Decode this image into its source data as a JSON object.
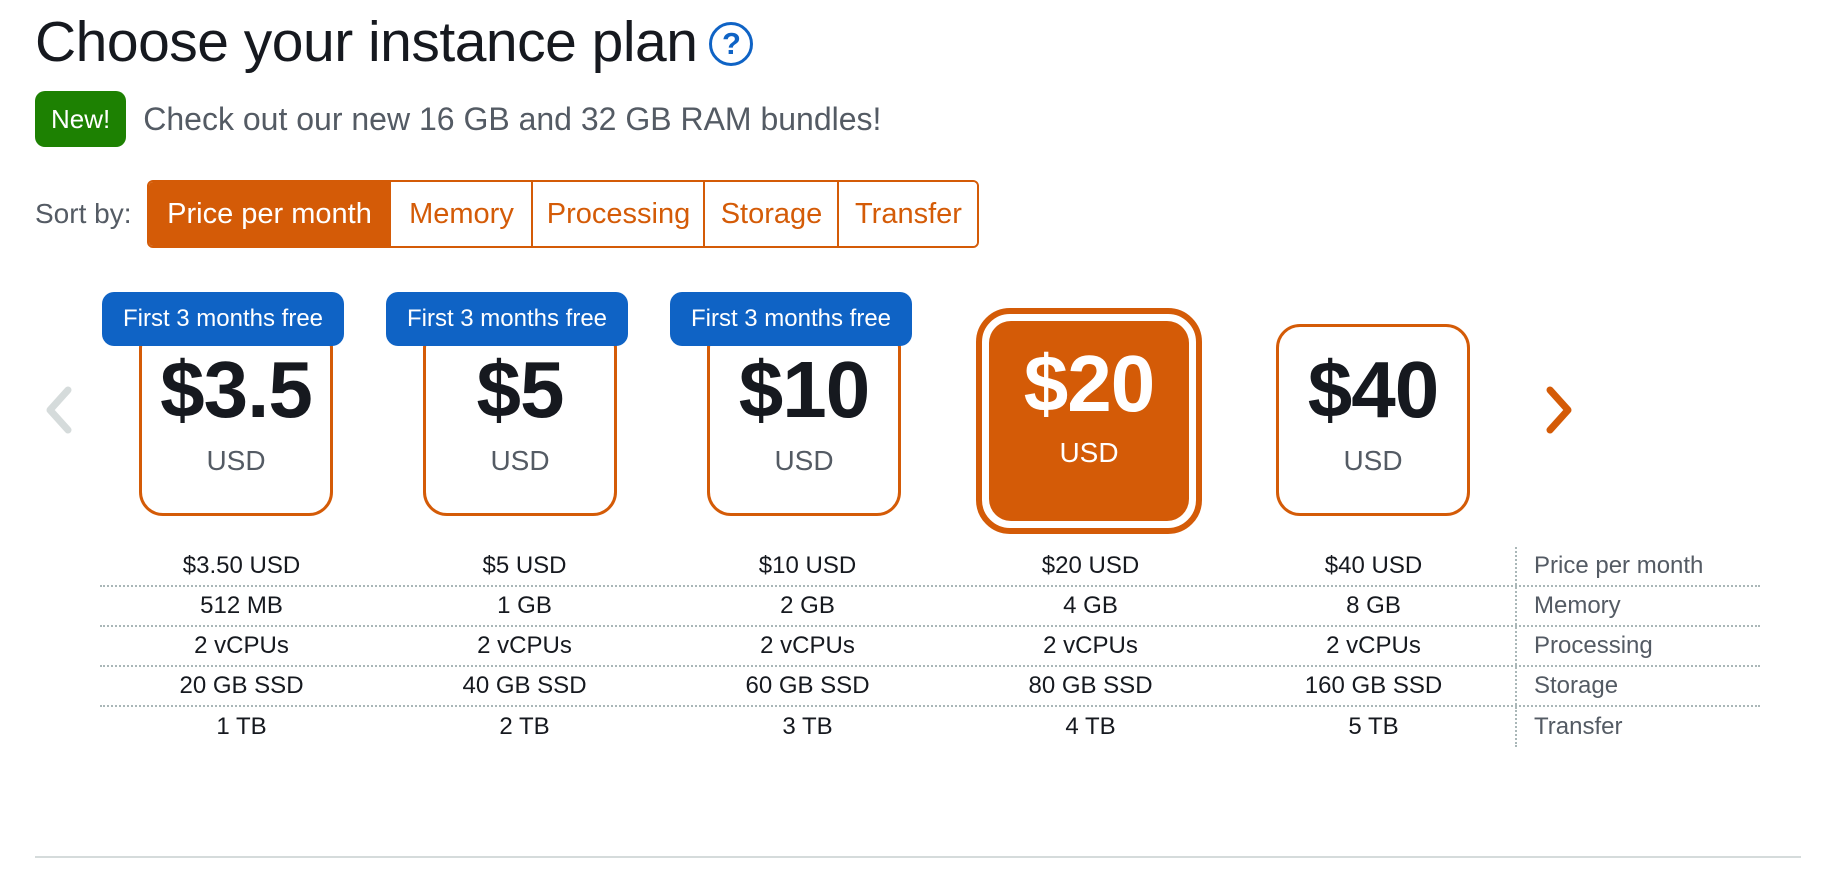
{
  "header": {
    "title": "Choose your instance plan",
    "help_icon": "help-circle-icon"
  },
  "announcement": {
    "badge": "New!",
    "text": "Check out our new 16 GB and 32 GB RAM bundles!"
  },
  "sort": {
    "label": "Sort by:",
    "options": [
      "Price per month",
      "Memory",
      "Processing",
      "Storage",
      "Transfer"
    ],
    "selected": "Price per month"
  },
  "navigation": {
    "prev_icon": "chevron-left-icon",
    "prev_enabled": false,
    "next_icon": "chevron-right-icon",
    "next_enabled": true
  },
  "plans": [
    {
      "promo": "First 3 months free",
      "price": "$3.5",
      "currency": "USD",
      "price_per_month": "$3.50 USD",
      "memory": "512 MB",
      "processing": "2 vCPUs",
      "storage": "20 GB SSD",
      "transfer": "1 TB",
      "selected": false
    },
    {
      "promo": "First 3 months free",
      "price": "$5",
      "currency": "USD",
      "price_per_month": "$5 USD",
      "memory": "1 GB",
      "processing": "2 vCPUs",
      "storage": "40 GB SSD",
      "transfer": "2 TB",
      "selected": false
    },
    {
      "promo": "First 3 months free",
      "price": "$10",
      "currency": "USD",
      "price_per_month": "$10 USD",
      "memory": "2 GB",
      "processing": "2 vCPUs",
      "storage": "60 GB SSD",
      "transfer": "3 TB",
      "selected": false
    },
    {
      "promo": "",
      "price": "$20",
      "currency": "USD",
      "price_per_month": "$20 USD",
      "memory": "4 GB",
      "processing": "2 vCPUs",
      "storage": "80 GB SSD",
      "transfer": "4 TB",
      "selected": true
    },
    {
      "promo": "",
      "price": "$40",
      "currency": "USD",
      "price_per_month": "$40 USD",
      "memory": "8 GB",
      "processing": "2 vCPUs",
      "storage": "160 GB SSD",
      "transfer": "5 TB",
      "selected": false
    }
  ],
  "spec_labels": {
    "price_per_month": "Price per month",
    "memory": "Memory",
    "processing": "Processing",
    "storage": "Storage",
    "transfer": "Transfer"
  },
  "colors": {
    "accent": "#d45b07",
    "promo": "#0f63c5",
    "new_badge": "#1d8102",
    "arrow_disabled": "#d5dbdb"
  }
}
